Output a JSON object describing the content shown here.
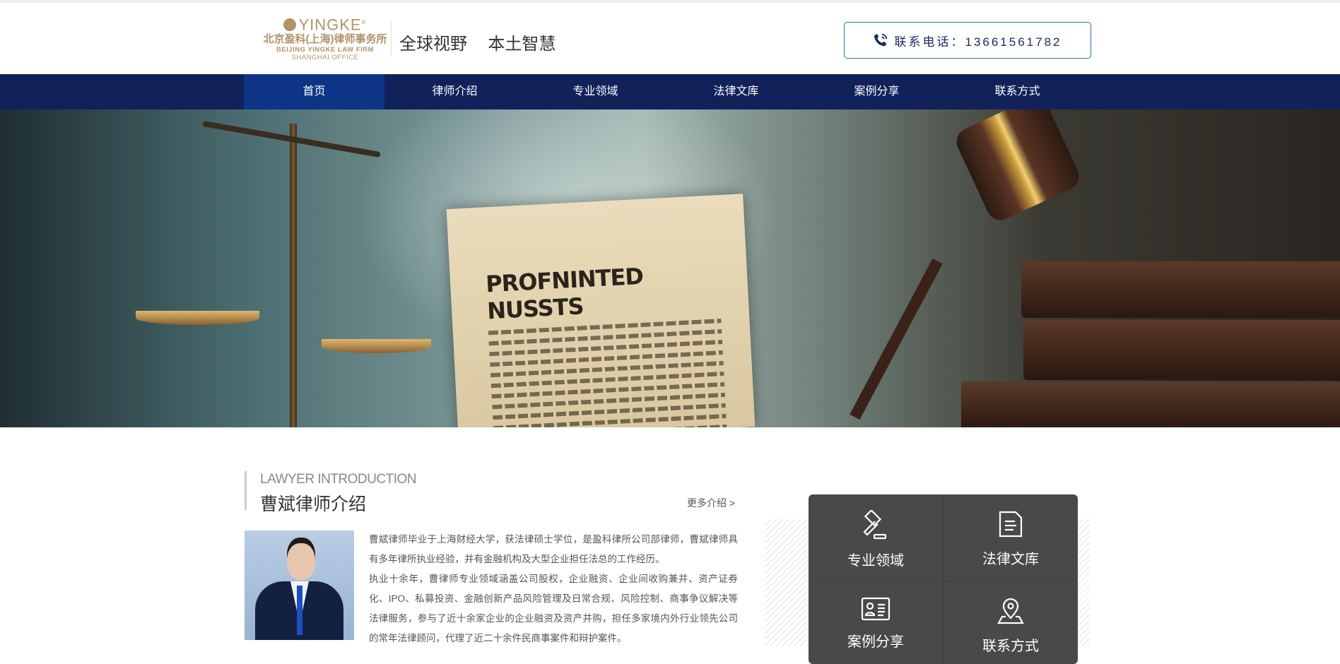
{
  "header": {
    "logo": {
      "brand": "YINGKE",
      "registered": "®",
      "name_cn": "北京盈科(上海)律师事务所",
      "name_en": "BEIJING YINGKE LAW FIRM",
      "office": "SHANGHAI OFFICE"
    },
    "slogan": "全球视野  本土智慧",
    "phone_label": "联系电话：13661561782"
  },
  "nav": {
    "items": [
      {
        "label": "首页",
        "active": true
      },
      {
        "label": "律师介绍"
      },
      {
        "label": "专业领域"
      },
      {
        "label": "法律文库"
      },
      {
        "label": "案例分享"
      },
      {
        "label": "联系方式"
      }
    ]
  },
  "banner": {
    "paper_heading": "PROFNINTED NUSSTS",
    "slide_count": 1,
    "active_slide": 1
  },
  "lawyer": {
    "section_en": "LAWYER INTRODUCTION",
    "section_cn": "曹斌律师介绍",
    "more_label": "更多介绍 >",
    "paragraphs": [
      "曹斌律师毕业于上海财经大学，获法律硕士学位，是盈科律所公司部律师，曹斌律师具有多年律所执业经验，并有金融机构及大型企业担任法总的工作经历。",
      "执业十余年，曹律师专业领域涵盖公司股权，企业融资、企业间收购兼并、资产证券化、IPO、私募投资、金融创新产品风险管理及日常合规、风险控制、商事争议解决等法律服务，参与了近十余家企业的企业融资及资产并购，担任多家境内外行业领先公司的常年法律顾问，代理了近二十余件民商事案件和辩护案件。"
    ]
  },
  "quick_links": [
    {
      "label": "专业领域",
      "icon": "gavel-icon"
    },
    {
      "label": "法律文库",
      "icon": "document-icon"
    },
    {
      "label": "案例分享",
      "icon": "id-card-icon"
    },
    {
      "label": "联系方式",
      "icon": "location-pin-icon"
    }
  ],
  "colors": {
    "nav_bg": "#11225a",
    "nav_active": "#0e3585",
    "brand_gold": "#b0936a",
    "panel_bg": "#48494b"
  }
}
